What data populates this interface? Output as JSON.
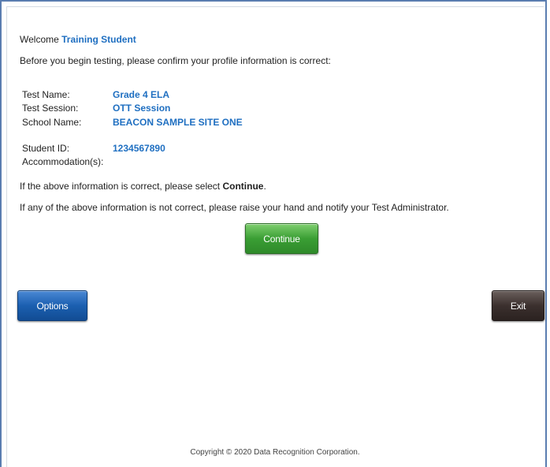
{
  "welcome": {
    "prefix": "Welcome",
    "student_name": "Training Student"
  },
  "intro": "Before you begin testing, please confirm your profile information is correct:",
  "profile": {
    "test_name_label": "Test Name:",
    "test_name_value": "Grade 4 ELA",
    "test_session_label": "Test Session:",
    "test_session_value": "OTT Session",
    "school_name_label": "School Name:",
    "school_name_value": "BEACON SAMPLE SITE ONE",
    "student_id_label": "Student ID:",
    "student_id_value": "1234567890",
    "accommodations_label": "Accommodation(s):"
  },
  "instructions": {
    "correct_prefix": "If the above information is correct, please select",
    "correct_action": "Continue",
    "correct_suffix": ".",
    "incorrect": "If any of the above information is not correct, please raise your hand and notify your Test Administrator."
  },
  "buttons": {
    "continue_label": "Continue",
    "options_label": "Options",
    "exit_label": "Exit"
  },
  "footer": {
    "copyright": "Copyright © 2020 Data Recognition Corporation."
  },
  "colors": {
    "accent": "#1f6fc1",
    "continue": "#3a9e34",
    "options": "#1b5fb0",
    "exit": "#3b302e"
  }
}
